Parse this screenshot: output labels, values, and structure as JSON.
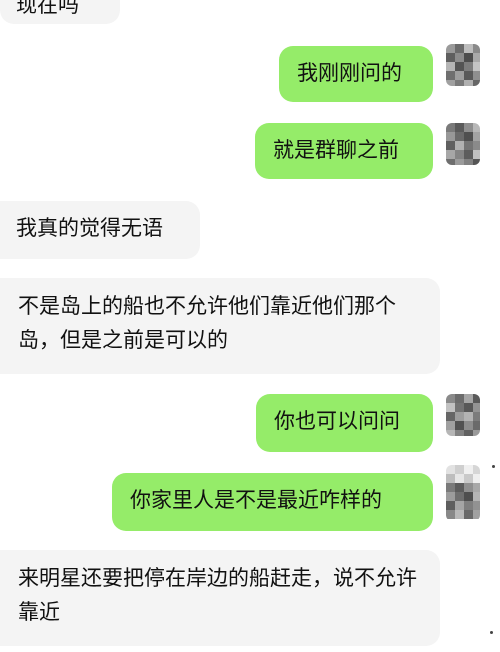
{
  "messages": [
    {
      "side": "in",
      "text": "现在吗"
    },
    {
      "side": "out",
      "text": "我刚刚问的"
    },
    {
      "side": "out",
      "text": "就是群聊之前"
    },
    {
      "side": "in",
      "text": "我真的觉得无语"
    },
    {
      "side": "in",
      "text": "不是岛上的船也不允许他们靠近他们那个岛，但是之前是可以的"
    },
    {
      "side": "out",
      "text": "你也可以问问"
    },
    {
      "side": "out",
      "text": "你家里人是不是最近咋样的"
    },
    {
      "side": "in",
      "text": "来明星还要把停在岸边的船赶走，说不允许靠近"
    }
  ],
  "colors": {
    "incoming_bubble": "#f4f4f4",
    "outgoing_bubble": "#95ec69",
    "background": "#ffffff"
  },
  "avatar_icon": "pixelated-avatar-icon"
}
